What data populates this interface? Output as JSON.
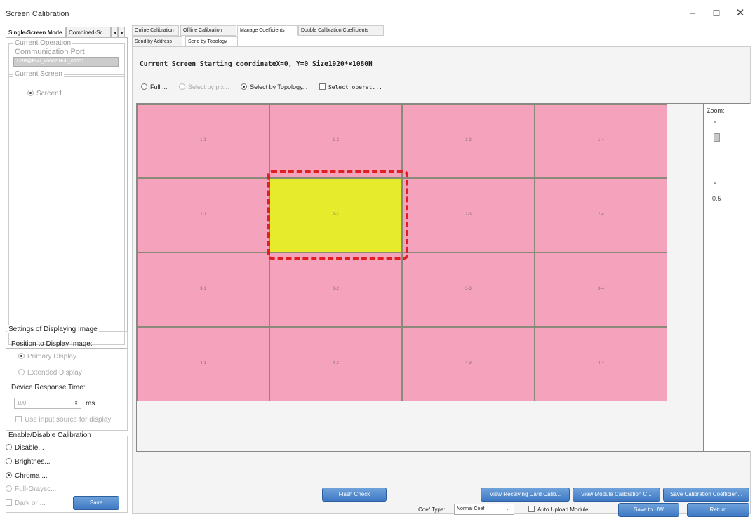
{
  "window": {
    "title": "Screen Calibration",
    "controls": {
      "minimize": "–",
      "maximize": "☐",
      "close": "✕"
    }
  },
  "left": {
    "tabs": [
      "Single-Screen Mode",
      "Combined-Sc",
      "◂",
      "▸"
    ],
    "current_operation_label": "Current Operation",
    "comm_port_label": "Communication Port",
    "comm_port_value": "USB@Port_#0002.Hub_#0001",
    "current_screen_label": "Current Screen",
    "screen_item": "Screen1",
    "display_settings": {
      "title": "Settings of Displaying Image",
      "position_label": "Position to Display Image:",
      "primary": "Primary Display",
      "extended": "Extended Display",
      "response_label": "Device Response Time:",
      "response_value": "100",
      "response_unit": "ms",
      "use_input": "Use input source for display"
    },
    "calibration": {
      "title": "Enable/Disable Calibration",
      "options": [
        "Disable...",
        "Brightnes...",
        "Chroma ...",
        "Full-Graysc...",
        "Dark or ..."
      ],
      "save": "Save"
    }
  },
  "main": {
    "tabs": [
      "Online Calibration",
      "Offline Calibration",
      "Manage Coefficients",
      "Double Calibration Coefficients"
    ],
    "subtabs": [
      "Send by Address",
      "Send by Topology"
    ],
    "current_screen": "Current Screen  Starting coordinateX=0, Y=0   Size1920*×1080H",
    "options": {
      "full": "Full ...",
      "by_pixel": "Select by pix...",
      "by_topology": "Select by Topology...",
      "select_sep": "Select operat..."
    },
    "grid": [
      [
        "1-1",
        "1-2",
        "1-3",
        "1-4"
      ],
      [
        "2-1",
        "2-2",
        "2-3",
        "2-4"
      ],
      [
        "3-1",
        "3-2",
        "3-3",
        "3-4"
      ],
      [
        "4-1",
        "4-2",
        "4-3",
        "4-4"
      ]
    ],
    "selected_cell": "2-2",
    "zoom": {
      "label": "Zoom:",
      "up": "^",
      "down": "v",
      "value": "0.5"
    },
    "buttons": {
      "flash": "Flash Check",
      "view_receiving": "View Receiving Card Calib...",
      "view_module": "View Module Calibration C...",
      "save_coeff": "Save Calibration Coefficien...",
      "save_hw": "Save to HW",
      "return": "Return"
    },
    "coef_type_label": "Coef Type:",
    "coef_type_value": "Normal Coef",
    "auto_upload": "Auto Upload Module"
  },
  "colors": {
    "cell": "#f5a3bd",
    "selected": "#e6ec2c",
    "selection_border": "#e02020",
    "button": "#3e79c4"
  }
}
